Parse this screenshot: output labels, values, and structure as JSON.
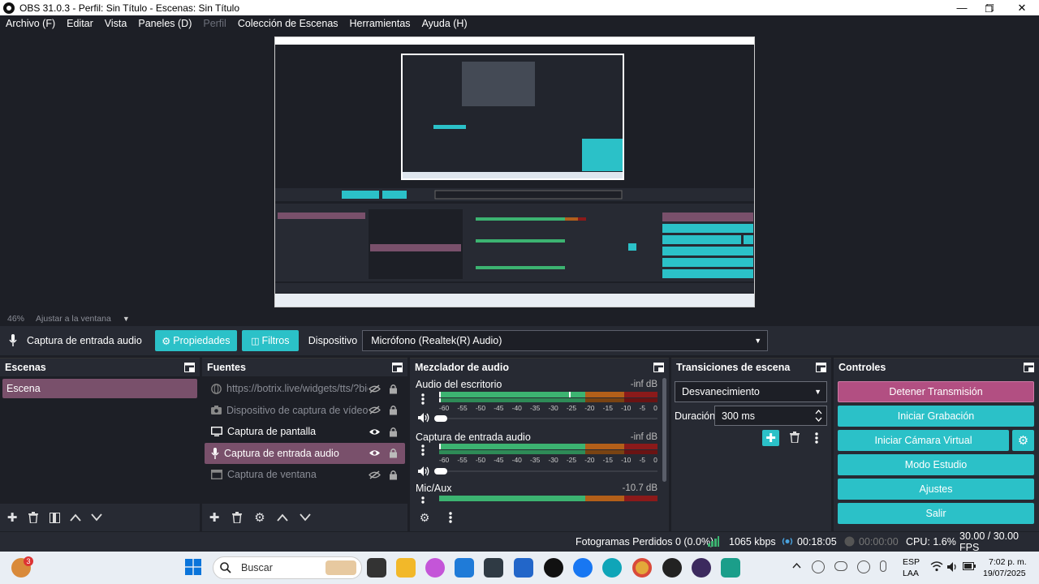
{
  "window": {
    "title": "OBS 31.0.3 - Perfil: Sin Título - Escenas: Sin Título"
  },
  "menu": [
    "Archivo (F)",
    "Editar",
    "Vista",
    "Paneles (D)",
    "Perfil",
    "Colección de Escenas",
    "Herramientas",
    "Ayuda (H)"
  ],
  "preview": {
    "zoom": "46%",
    "fit_label": "Ajustar a la ventana"
  },
  "context": {
    "source_name": "Captura de entrada audio",
    "properties_label": "Propiedades",
    "filters_label": "Filtros",
    "device_label": "Dispositivo",
    "device_value": "Micrófono (Realtek(R) Audio)"
  },
  "scenes": {
    "title": "Escenas",
    "items": [
      "Escena"
    ]
  },
  "sources": {
    "title": "Fuentes",
    "items": [
      {
        "label": "https://botrix.live/widgets/tts/?bid=\\",
        "visible": false
      },
      {
        "label": "Dispositivo de captura de vídeo",
        "visible": false
      },
      {
        "label": "Captura de pantalla",
        "visible": true
      },
      {
        "label": "Captura de entrada audio",
        "visible": true
      },
      {
        "label": "Captura de ventana",
        "visible": false
      }
    ]
  },
  "mixer": {
    "title": "Mezclador de audio",
    "ticks": [
      "-60",
      "-55",
      "-50",
      "-45",
      "-40",
      "-35",
      "-30",
      "-25",
      "-20",
      "-15",
      "-10",
      "-5",
      "0"
    ],
    "channels": [
      {
        "name": "Audio del escritorio",
        "db": "-inf dB"
      },
      {
        "name": "Captura de entrada audio",
        "db": "-inf dB"
      },
      {
        "name": "Mic/Aux",
        "db": "-10.7 dB"
      }
    ]
  },
  "transitions": {
    "title": "Transiciones de escena",
    "type": "Desvanecimiento",
    "duration_label": "Duración",
    "duration_value": "300 ms"
  },
  "controls": {
    "title": "Controles",
    "stop_stream": "Detener Transmisión",
    "start_recording": "Iniciar Grabación",
    "virtual_camera": "Iniciar Cámara Virtual",
    "studio_mode": "Modo Estudio",
    "settings": "Ajustes",
    "exit": "Salir"
  },
  "status": {
    "dropped": "Fotogramas Perdidos 0 (0.0%)",
    "bitrate": "1065 kbps",
    "stream_time": "00:18:05",
    "rec_time": "00:00:00",
    "cpu": "CPU: 1.6%",
    "fps": "30.00 / 30.00 FPS"
  },
  "taskbar": {
    "search": "Buscar",
    "badge": "3",
    "lang1": "ESP",
    "lang2": "LAA",
    "time": "7:02 p. m.",
    "date": "19/07/2025"
  },
  "colors": {
    "accent": "#2bc1c8",
    "selected": "#79506b",
    "bg": "#1d1f26",
    "panel": "#272a33"
  }
}
